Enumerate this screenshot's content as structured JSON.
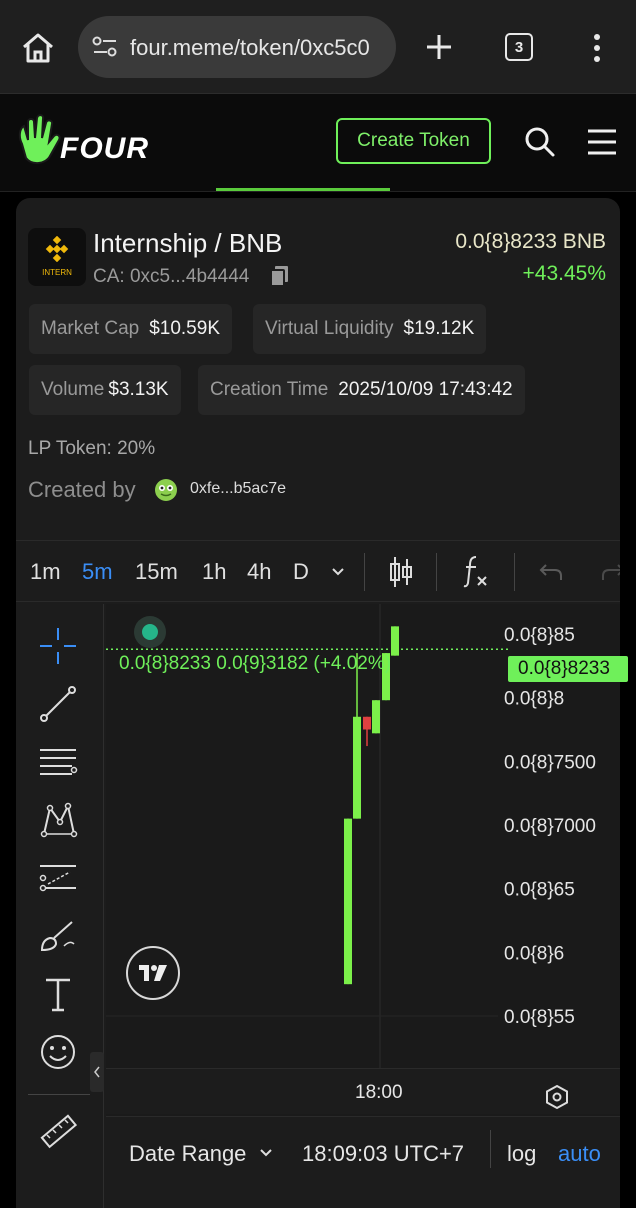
{
  "browser": {
    "url": "four.meme/token/0xc5c0",
    "tab_count": "3"
  },
  "header": {
    "logo": "FOUR",
    "create_button": "Create Token"
  },
  "token": {
    "name": "Internship / BNB",
    "icon_label": "INTERN",
    "ca": "CA: 0xc5...4b4444",
    "price": "0.0{8}8233 BNB",
    "change": "+43.45%"
  },
  "stats": {
    "market_cap_label": "Market Cap",
    "market_cap_value": "$10.59K",
    "virtual_liquidity_label": "Virtual Liquidity",
    "virtual_liquidity_value": "$19.12K",
    "volume_label": "Volume",
    "volume_value": "$3.13K",
    "creation_time_label": "Creation Time",
    "creation_time_value": "2025/10/09 17:43:42",
    "lp_token": "LP Token: 20%",
    "created_by_label": "Created by",
    "creator": "0xfe...b5ac7e"
  },
  "timeframes": [
    "1m",
    "5m",
    "15m",
    "1h",
    "4h",
    "D"
  ],
  "active_timeframe": "5m",
  "chart_bottom": {
    "date_range": "Date Range",
    "time": "18:09:03 UTC+7",
    "log": "log",
    "auto": "auto"
  },
  "colors": {
    "accent_green": "#6ff05a",
    "candle_up": "#7cf04a",
    "candle_down": "#e04040",
    "active_blue": "#3a8ef6"
  },
  "chart_data": {
    "type": "candlestick",
    "legend": "0.0{8}8233  0.0{9}3182 (+4.02%)",
    "last_price_label": "0.0{8}8233",
    "y_tick_labels": [
      "0.0{8}85",
      "0.0{8}8",
      "0.0{8}7500",
      "0.0{8}7000",
      "0.0{8}65",
      "0.0{8}6",
      "0.0{8}55"
    ],
    "y_ticks_value": [
      8.5,
      8.0,
      7.5,
      7.0,
      6.5,
      6.0,
      5.5
    ],
    "x_tick_labels": [
      "18:00"
    ],
    "ylim": [
      5.45,
      8.6
    ],
    "candles": [
      {
        "open": 5.75,
        "close": 7.05,
        "high": 7.05,
        "low": 5.75,
        "dir": "up"
      },
      {
        "open": 7.05,
        "close": 7.85,
        "high": 8.35,
        "low": 7.05,
        "dir": "up"
      },
      {
        "open": 7.85,
        "close": 7.75,
        "high": 7.85,
        "low": 7.62,
        "dir": "down"
      },
      {
        "open": 7.72,
        "close": 7.98,
        "high": 7.98,
        "low": 7.72,
        "dir": "up"
      },
      {
        "open": 7.98,
        "close": 8.35,
        "high": 8.35,
        "low": 7.98,
        "dir": "up"
      },
      {
        "open": 8.33,
        "close": 8.56,
        "high": 8.56,
        "low": 8.33,
        "dir": "up"
      }
    ]
  }
}
